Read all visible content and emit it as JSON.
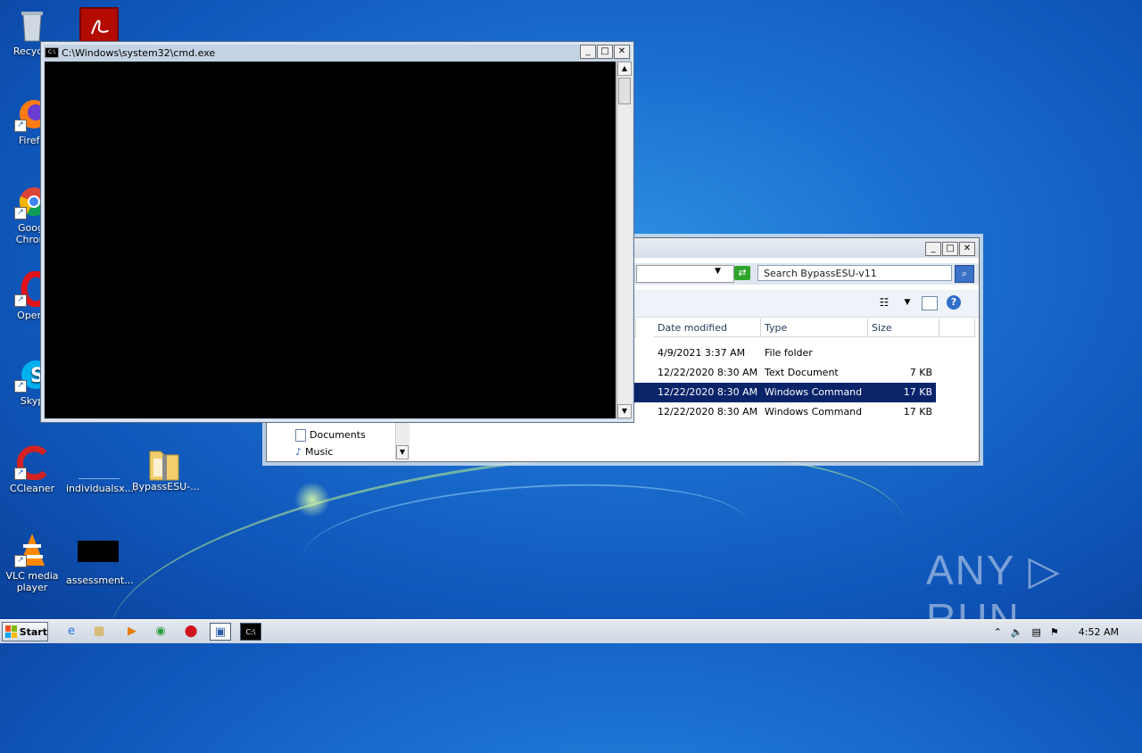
{
  "desktop": {
    "icons": [
      {
        "label": "Recycle",
        "icon": "recycle-bin-icon"
      },
      {
        "label": "Firefo",
        "icon": "firefox-icon"
      },
      {
        "label": "Googl\nChrom",
        "icon": "chrome-icon"
      },
      {
        "label": "Opera",
        "icon": "opera-icon"
      },
      {
        "label": "Skyp",
        "icon": "skype-icon"
      },
      {
        "label": "CCleaner",
        "icon": "ccleaner-icon"
      },
      {
        "label": "individualsx....",
        "icon": "document-icon"
      },
      {
        "label": "BypassESU-...",
        "icon": "zip-folder-icon"
      },
      {
        "label": "VLC media player",
        "icon": "vlc-icon"
      },
      {
        "label": "assessment...",
        "icon": "black-thumbnail-icon"
      }
    ],
    "watermark": "ANY ▷ RUN"
  },
  "cmd_window": {
    "title": "C:\\Windows\\system32\\cmd.exe",
    "minimize": "_",
    "maximize": "□",
    "close": "✕"
  },
  "explorer": {
    "minimize": "_",
    "maximize": "□",
    "close": "✕",
    "search_placeholder": "Search BypassESU-v11",
    "columns": [
      "Date modified",
      "Type",
      "Size"
    ],
    "rows": [
      {
        "date": "4/9/2021 3:37 AM",
        "type": "File folder",
        "size": ""
      },
      {
        "date": "12/22/2020 8:30 AM",
        "type": "Text Document",
        "size": "7 KB"
      },
      {
        "date": "12/22/2020 8:30 AM",
        "type": "Windows Command ...",
        "size": "17 KB"
      },
      {
        "date": "12/22/2020 8:30 AM",
        "type": "Windows Command ...",
        "size": "17 KB"
      }
    ],
    "nav": [
      "Documents",
      "Music"
    ]
  },
  "taskbar": {
    "start_label": "Start",
    "clock": "4:52 AM"
  }
}
